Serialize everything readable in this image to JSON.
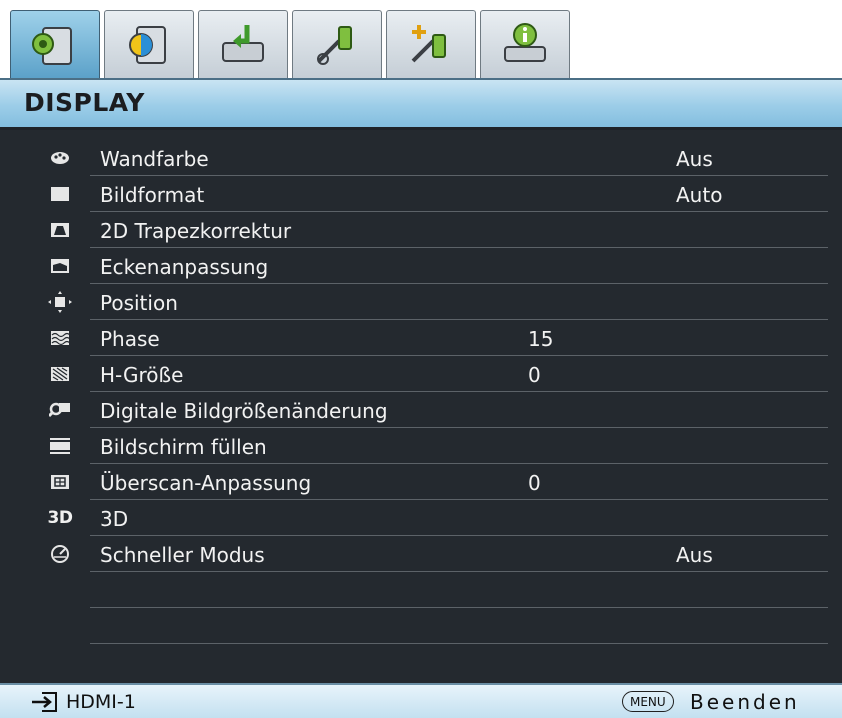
{
  "tabs": [
    {
      "icon": "display-settings-icon",
      "active": true
    },
    {
      "icon": "picture-icon",
      "active": false
    },
    {
      "icon": "source-input-icon",
      "active": false
    },
    {
      "icon": "system-setup-basic-icon",
      "active": false
    },
    {
      "icon": "system-setup-advanced-icon",
      "active": false
    },
    {
      "icon": "information-icon",
      "active": false
    }
  ],
  "title": "DISPLAY",
  "menu": [
    {
      "icon": "wall-color-icon",
      "label": "Wandfarbe",
      "value1": "",
      "value2": "Aus"
    },
    {
      "icon": "aspect-ratio-icon",
      "label": "Bildformat",
      "value1": "",
      "value2": "Auto"
    },
    {
      "icon": "keystone-icon",
      "label": "2D Trapezkorrektur",
      "value1": "",
      "value2": ""
    },
    {
      "icon": "corner-fit-icon",
      "label": "Eckenanpassung",
      "value1": "",
      "value2": ""
    },
    {
      "icon": "position-icon",
      "label": "Position",
      "value1": "",
      "value2": ""
    },
    {
      "icon": "phase-icon",
      "label": "Phase",
      "value1": "15",
      "value2": ""
    },
    {
      "icon": "h-size-icon",
      "label": "H-Größe",
      "value1": "0",
      "value2": ""
    },
    {
      "icon": "digital-zoom-icon",
      "label": "Digitale Bildgrößenänderung",
      "value1": "",
      "value2": ""
    },
    {
      "icon": "screen-fill-icon",
      "label": "Bildschirm füllen",
      "value1": "",
      "value2": ""
    },
    {
      "icon": "overscan-icon",
      "label": "Überscan-Anpassung",
      "value1": "0",
      "value2": ""
    },
    {
      "icon": "3d-icon",
      "icon_text": "3D",
      "label": "3D",
      "value1": "",
      "value2": ""
    },
    {
      "icon": "quick-mode-icon",
      "label": "Schneller Modus",
      "value1": "",
      "value2": "Aus"
    },
    {
      "icon": "",
      "label": "",
      "value1": "",
      "value2": ""
    }
  ],
  "footer": {
    "source_icon": "input-source-icon",
    "source": "HDMI-1",
    "menu_key": "MENU",
    "exit": "Beenden"
  }
}
